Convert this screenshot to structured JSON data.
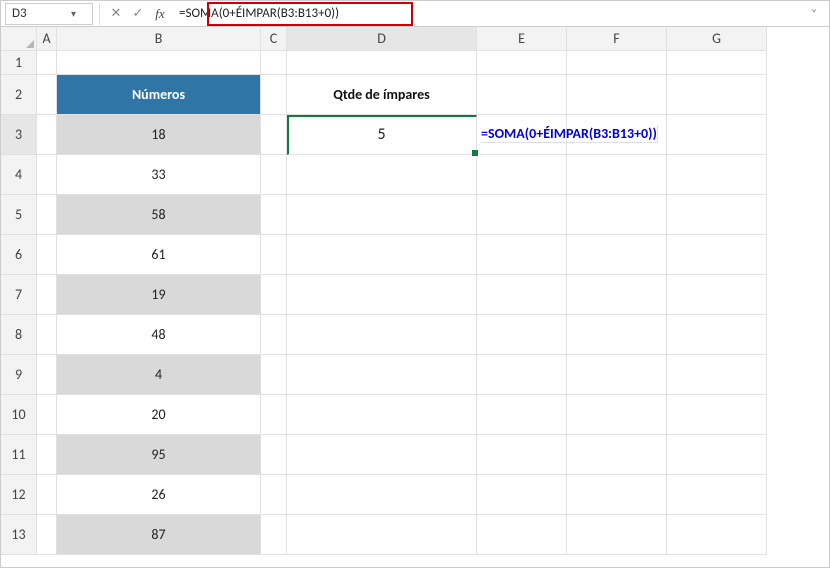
{
  "namebox": {
    "value": "D3"
  },
  "formula_bar": {
    "formula": "=SOMA(0+ÉIMPAR(B3:B13+0))"
  },
  "column_headers": [
    "A",
    "B",
    "C",
    "D",
    "E",
    "F",
    "G"
  ],
  "row_headers": [
    "1",
    "2",
    "3",
    "4",
    "5",
    "6",
    "7",
    "8",
    "9",
    "10",
    "11",
    "12",
    "13"
  ],
  "headers": {
    "b": "Números",
    "d": "Qtde de ímpares"
  },
  "values_b": [
    "18",
    "33",
    "58",
    "61",
    "19",
    "48",
    "4",
    "20",
    "95",
    "26",
    "87"
  ],
  "d3": "5",
  "annotation": "=SOMA(0+ÉIMPAR(B3:B13+0))"
}
